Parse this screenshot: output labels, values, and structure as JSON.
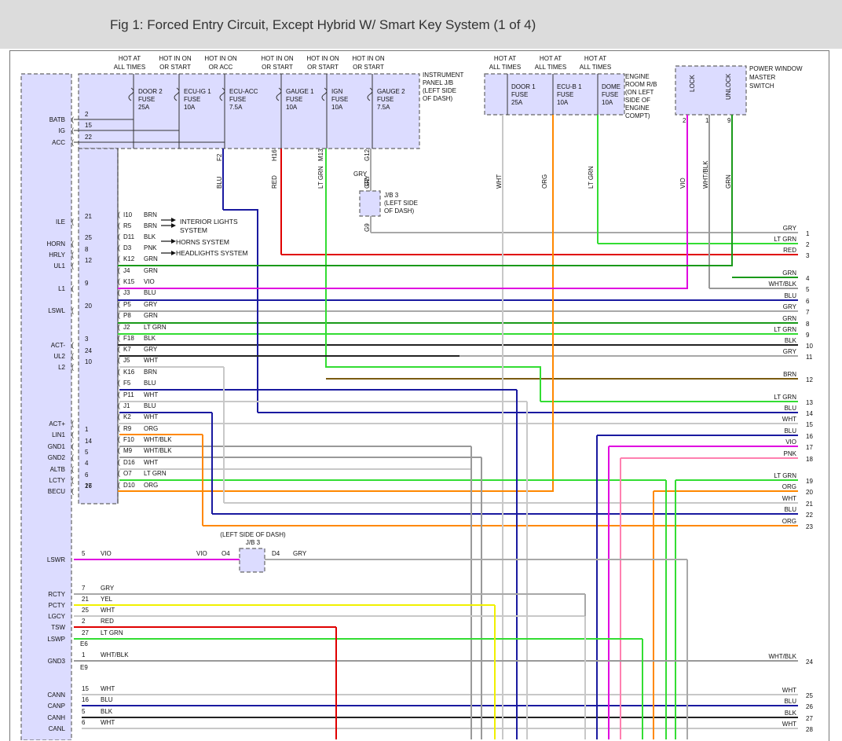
{
  "header": {
    "title": "Fig 1: Forced Entry Circuit, Except Hybrid W/ Smart Key System (1 of 4)"
  },
  "colors": {
    "box_fill": "#dcdcff",
    "WHT": "#c8c8c8",
    "GRY": "#a8a8a8",
    "BLU": "#1a1aa0",
    "RED": "#e00000",
    "LT GRN": "#33dd33",
    "GRN": "#1a9a1a",
    "BLK": "#222222",
    "VIO": "#e000e0",
    "ORG": "#ff8800",
    "BRN": "#7a5a10",
    "PNK": "#ff80b0",
    "WHT/BLK": "#999999",
    "YEL": "#f0f000"
  },
  "ecu_pins": [
    {
      "label": "BATB",
      "pin": "2"
    },
    {
      "label": "IG",
      "pin": "15"
    },
    {
      "label": "ACC",
      "pin": "22"
    },
    {
      "label": "ILE",
      "pin": "21"
    },
    {
      "label": "HORN",
      "pin": "25"
    },
    {
      "label": "HRLY",
      "pin": "8"
    },
    {
      "label": "UL1",
      "pin": "12"
    },
    {
      "label": "L1",
      "pin": "9"
    },
    {
      "label": "LSWL",
      "pin": "20"
    },
    {
      "label": "ACT-",
      "pin": "3"
    },
    {
      "label": "UL2",
      "pin": "24"
    },
    {
      "label": "L2",
      "pin": "10"
    },
    {
      "label": "ACT+",
      "pin": ""
    },
    {
      "label": "LIN1",
      "pin": "1"
    },
    {
      "label": "GND1",
      "pin": "14"
    },
    {
      "label": "GND2",
      "pin": "5"
    },
    {
      "label": "ALTB",
      "pin": "4"
    },
    {
      "label": "LCTY",
      "pin": "6"
    },
    {
      "label": "BECU",
      "pin": "17"
    },
    {
      "label": "",
      "pin": "26"
    }
  ],
  "jb_headers": [
    {
      "l1": "HOT AT",
      "l2": "ALL TIMES"
    },
    {
      "l1": "HOT IN ON",
      "l2": "OR START"
    },
    {
      "l1": "HOT IN ON",
      "l2": "OR ACC"
    },
    {
      "l1": "HOT IN ON",
      "l2": "OR START"
    },
    {
      "l1": "HOT IN ON",
      "l2": "OR START"
    },
    {
      "l1": "HOT IN ON",
      "l2": "OR START"
    }
  ],
  "jb_fuses": [
    {
      "n": "DOOR 2",
      "f": "FUSE",
      "a": "25A"
    },
    {
      "n": "ECU-IG 1",
      "f": "FUSE",
      "a": "10A"
    },
    {
      "n": "ECU-ACC",
      "f": "FUSE",
      "a": "7.5A"
    },
    {
      "n": "GAUGE 1",
      "f": "FUSE",
      "a": "10A"
    },
    {
      "n": "IGN",
      "f": "FUSE",
      "a": "10A"
    },
    {
      "n": "GAUGE 2",
      "f": "FUSE",
      "a": "7.5A"
    }
  ],
  "jb_label": [
    "INSTRUMENT",
    "PANEL J/B",
    "(LEFT SIDE",
    "OF DASH)"
  ],
  "er_headers": [
    {
      "l1": "HOT AT",
      "l2": "ALL TIMES"
    },
    {
      "l1": "HOT AT",
      "l2": "ALL TIMES"
    },
    {
      "l1": "HOT AT",
      "l2": "ALL TIMES"
    }
  ],
  "er_fuses": [
    {
      "n": "DOOR 1",
      "f": "FUSE",
      "a": "25A"
    },
    {
      "n": "ECU-B 1",
      "f": "FUSE",
      "a": "10A"
    },
    {
      "n": "DOME",
      "f": "FUSE",
      "a": "10A"
    }
  ],
  "er_label": [
    "ENGINE",
    "ROOM R/B",
    "(ON LEFT",
    "SIDE OF",
    "ENGINE",
    "COMPT)"
  ],
  "pw_label": [
    "POWER WINDOW",
    "MASTER",
    "SWITCH"
  ],
  "pw_switch": {
    "lock": "LOCK",
    "unlock": "UNLOCK"
  },
  "pw_pins": [
    "2",
    "1",
    "9"
  ],
  "vertical_wire_labels": [
    {
      "code": "F2",
      "color": "BLU"
    },
    {
      "code": "H16",
      "color": "RED"
    },
    {
      "code": "M13",
      "color": "LT GRN"
    },
    {
      "code": "G12",
      "color": "GRY"
    },
    {
      "code": "",
      "color": "WHT"
    },
    {
      "code": "",
      "color": "ORG"
    },
    {
      "code": "",
      "color": "LT GRN"
    },
    {
      "code": "",
      "color": "VIO"
    },
    {
      "code": "",
      "color": "WHT/BLK"
    },
    {
      "code": "",
      "color": "GRN"
    }
  ],
  "jb3": {
    "pin_top": "G2",
    "pin_bot": "G9",
    "label": [
      "J/B 3",
      "(LEFT SIDE",
      "OF DASH)"
    ],
    "wire": "GRY"
  },
  "jb3b": {
    "title": "(LEFT SIDE OF DASH)",
    "name": "J/B 3",
    "pin_l": "O4",
    "pin_r": "D4",
    "wire_l": "VIO",
    "wire_r": "GRY"
  },
  "branch_wires": [
    {
      "conn": "I10",
      "color": "BRN"
    },
    {
      "conn": "R5",
      "color": "BRN"
    },
    {
      "conn": "D11",
      "color": "BLK"
    },
    {
      "conn": "D3",
      "color": "PNK"
    },
    {
      "conn": "K12",
      "color": "GRN"
    },
    {
      "conn": "J4",
      "color": "GRN"
    },
    {
      "conn": "K15",
      "color": "VIO"
    },
    {
      "conn": "J3",
      "color": "BLU"
    },
    {
      "conn": "P5",
      "color": "GRY"
    },
    {
      "conn": "P8",
      "color": "GRN"
    },
    {
      "conn": "J2",
      "color": "LT GRN"
    },
    {
      "conn": "F18",
      "color": "BLK"
    },
    {
      "conn": "K7",
      "color": "GRY"
    },
    {
      "conn": "J5",
      "color": "WHT"
    },
    {
      "conn": "K16",
      "color": "BRN"
    },
    {
      "conn": "F5",
      "color": "BLU"
    },
    {
      "conn": "P11",
      "color": "WHT"
    },
    {
      "conn": "J1",
      "color": "BLU"
    },
    {
      "conn": "K2",
      "color": "WHT"
    },
    {
      "conn": "R9",
      "color": "ORG"
    },
    {
      "conn": "F10",
      "color": "WHT/BLK"
    },
    {
      "conn": "M9",
      "color": "WHT/BLK"
    },
    {
      "conn": "D16",
      "color": "WHT"
    },
    {
      "conn": "O7",
      "color": "LT GRN"
    },
    {
      "conn": "D10",
      "color": "ORG"
    }
  ],
  "systems": [
    "INTERIOR LIGHTS",
    "SYSTEM",
    "HORNS SYSTEM",
    "HEADLIGHTS SYSTEM"
  ],
  "right_wires": [
    {
      "n": "1",
      "c": "GRY"
    },
    {
      "n": "2",
      "c": "LT GRN"
    },
    {
      "n": "3",
      "c": "RED"
    },
    {
      "n": "4",
      "c": "GRN"
    },
    {
      "n": "5",
      "c": "WHT/BLK"
    },
    {
      "n": "6",
      "c": "BLU"
    },
    {
      "n": "7",
      "c": "GRY"
    },
    {
      "n": "8",
      "c": "GRN"
    },
    {
      "n": "9",
      "c": "LT GRN"
    },
    {
      "n": "10",
      "c": "BLK"
    },
    {
      "n": "11",
      "c": "GRY"
    },
    {
      "n": "12",
      "c": "BRN"
    },
    {
      "n": "13",
      "c": "LT GRN"
    },
    {
      "n": "14",
      "c": "BLU"
    },
    {
      "n": "15",
      "c": "WHT"
    },
    {
      "n": "16",
      "c": "BLU"
    },
    {
      "n": "17",
      "c": "VIO"
    },
    {
      "n": "18",
      "c": "PNK"
    },
    {
      "n": "19",
      "c": "LT GRN"
    },
    {
      "n": "20",
      "c": "ORG"
    },
    {
      "n": "21",
      "c": "WHT"
    },
    {
      "n": "22",
      "c": "BLU"
    },
    {
      "n": "23",
      "c": "ORG"
    },
    {
      "n": "24",
      "c": "WHT/BLK"
    },
    {
      "n": "25",
      "c": "WHT"
    },
    {
      "n": "26",
      "c": "BLU"
    },
    {
      "n": "27",
      "c": "BLK"
    },
    {
      "n": "28",
      "c": "WHT"
    }
  ],
  "lower_pins": [
    {
      "label": "LSWR",
      "pin": "5",
      "color": "VIO"
    },
    {
      "label": "RCTY",
      "pin": "7",
      "color": "GRY"
    },
    {
      "label": "PCTY",
      "pin": "21",
      "color": "YEL"
    },
    {
      "label": "LGCY",
      "pin": "25",
      "color": "WHT"
    },
    {
      "label": "TSW",
      "pin": "2",
      "color": "RED"
    },
    {
      "label": "LSWP",
      "pin": "27",
      "color": "LT GRN"
    },
    {
      "label": "GND3",
      "pin": "1",
      "color": "WHT/BLK"
    },
    {
      "label": "CANN",
      "pin": "15",
      "color": "WHT"
    },
    {
      "label": "CANP",
      "pin": "16",
      "color": "BLU"
    },
    {
      "label": "CANH",
      "pin": "5",
      "color": "BLK"
    },
    {
      "label": "CANL",
      "pin": "6",
      "color": "WHT"
    }
  ],
  "lower_connectors": [
    "E6",
    "E9"
  ]
}
